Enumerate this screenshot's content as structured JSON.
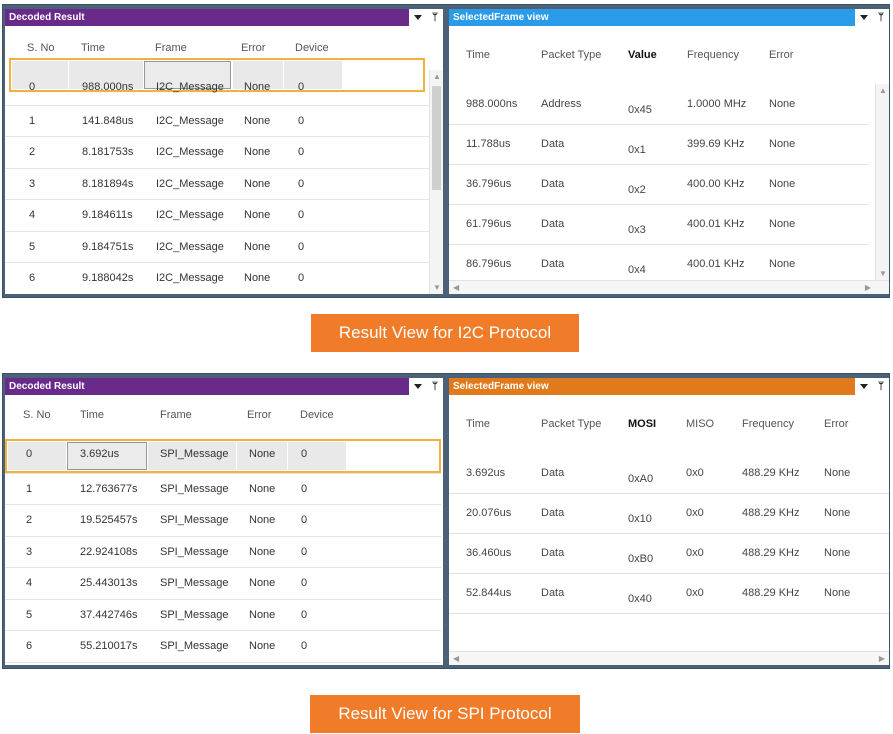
{
  "i2c": {
    "decoded": {
      "title": "Decoded Result",
      "columns": [
        "S. No",
        "Time",
        "Frame",
        "Error",
        "Device"
      ],
      "rows": [
        [
          "0",
          "988.000ns",
          "I2C_Message",
          "None",
          "0"
        ],
        [
          "1",
          "141.848us",
          "I2C_Message",
          "None",
          "0"
        ],
        [
          "2",
          "8.181753s",
          "I2C_Message",
          "None",
          "0"
        ],
        [
          "3",
          "8.181894s",
          "I2C_Message",
          "None",
          "0"
        ],
        [
          "4",
          "9.184611s",
          "I2C_Message",
          "None",
          "0"
        ],
        [
          "5",
          "9.184751s",
          "I2C_Message",
          "None",
          "0"
        ],
        [
          "6",
          "9.188042s",
          "I2C_Message",
          "None",
          "0"
        ]
      ]
    },
    "frame": {
      "title": "SelectedFrame view",
      "columns": [
        "Time",
        "Packet Type",
        "Value",
        "Frequency",
        "Error"
      ],
      "rows": [
        [
          "988.000ns",
          "Address",
          "0x45",
          "1.0000 MHz",
          "None"
        ],
        [
          "11.788us",
          "Data",
          "0x1",
          "399.69 KHz",
          "None"
        ],
        [
          "36.796us",
          "Data",
          "0x2",
          "400.00 KHz",
          "None"
        ],
        [
          "61.796us",
          "Data",
          "0x3",
          "400.01 KHz",
          "None"
        ],
        [
          "86.796us",
          "Data",
          "0x4",
          "400.01 KHz",
          "None"
        ]
      ]
    },
    "caption": "Result View for I2C Protocol"
  },
  "spi": {
    "decoded": {
      "title": "Decoded Result",
      "columns": [
        "S. No",
        "Time",
        "Frame",
        "Error",
        "Device"
      ],
      "rows": [
        [
          "0",
          "3.692us",
          "SPI_Message",
          "None",
          "0"
        ],
        [
          "1",
          "12.763677s",
          "SPI_Message",
          "None",
          "0"
        ],
        [
          "2",
          "19.525457s",
          "SPI_Message",
          "None",
          "0"
        ],
        [
          "3",
          "22.924108s",
          "SPI_Message",
          "None",
          "0"
        ],
        [
          "4",
          "25.443013s",
          "SPI_Message",
          "None",
          "0"
        ],
        [
          "5",
          "37.442746s",
          "SPI_Message",
          "None",
          "0"
        ],
        [
          "6",
          "55.210017s",
          "SPI_Message",
          "None",
          "0"
        ]
      ]
    },
    "frame": {
      "title": "SelectedFrame view",
      "columns": [
        "Time",
        "Packet Type",
        "MOSI",
        "MISO",
        "Frequency",
        "Error"
      ],
      "rows": [
        [
          "3.692us",
          "Data",
          "0xA0",
          "0x0",
          "488.29 KHz",
          "None"
        ],
        [
          "20.076us",
          "Data",
          "0x10",
          "0x0",
          "488.29 KHz",
          "None"
        ],
        [
          "36.460us",
          "Data",
          "0xB0",
          "0x0",
          "488.29 KHz",
          "None"
        ],
        [
          "52.844us",
          "Data",
          "0x40",
          "0x0",
          "488.29 KHz",
          "None"
        ]
      ]
    },
    "caption": "Result View for SPI Protocol"
  },
  "colors": {
    "decoded_title_bg": "#6a2a8a",
    "i2c_frame_title_bg": "#2a9be8",
    "spi_frame_title_bg": "#e07a1a",
    "selection_border": "#f0b23a",
    "caption_bg": "#f07c2a",
    "frame_border": "#4a6178"
  },
  "icons": [
    "dropdown-triangle-icon",
    "pin-icon",
    "scroll-up-arrow-icon",
    "scroll-down-arrow-icon",
    "scroll-left-arrow-icon",
    "scroll-right-arrow-icon"
  ]
}
